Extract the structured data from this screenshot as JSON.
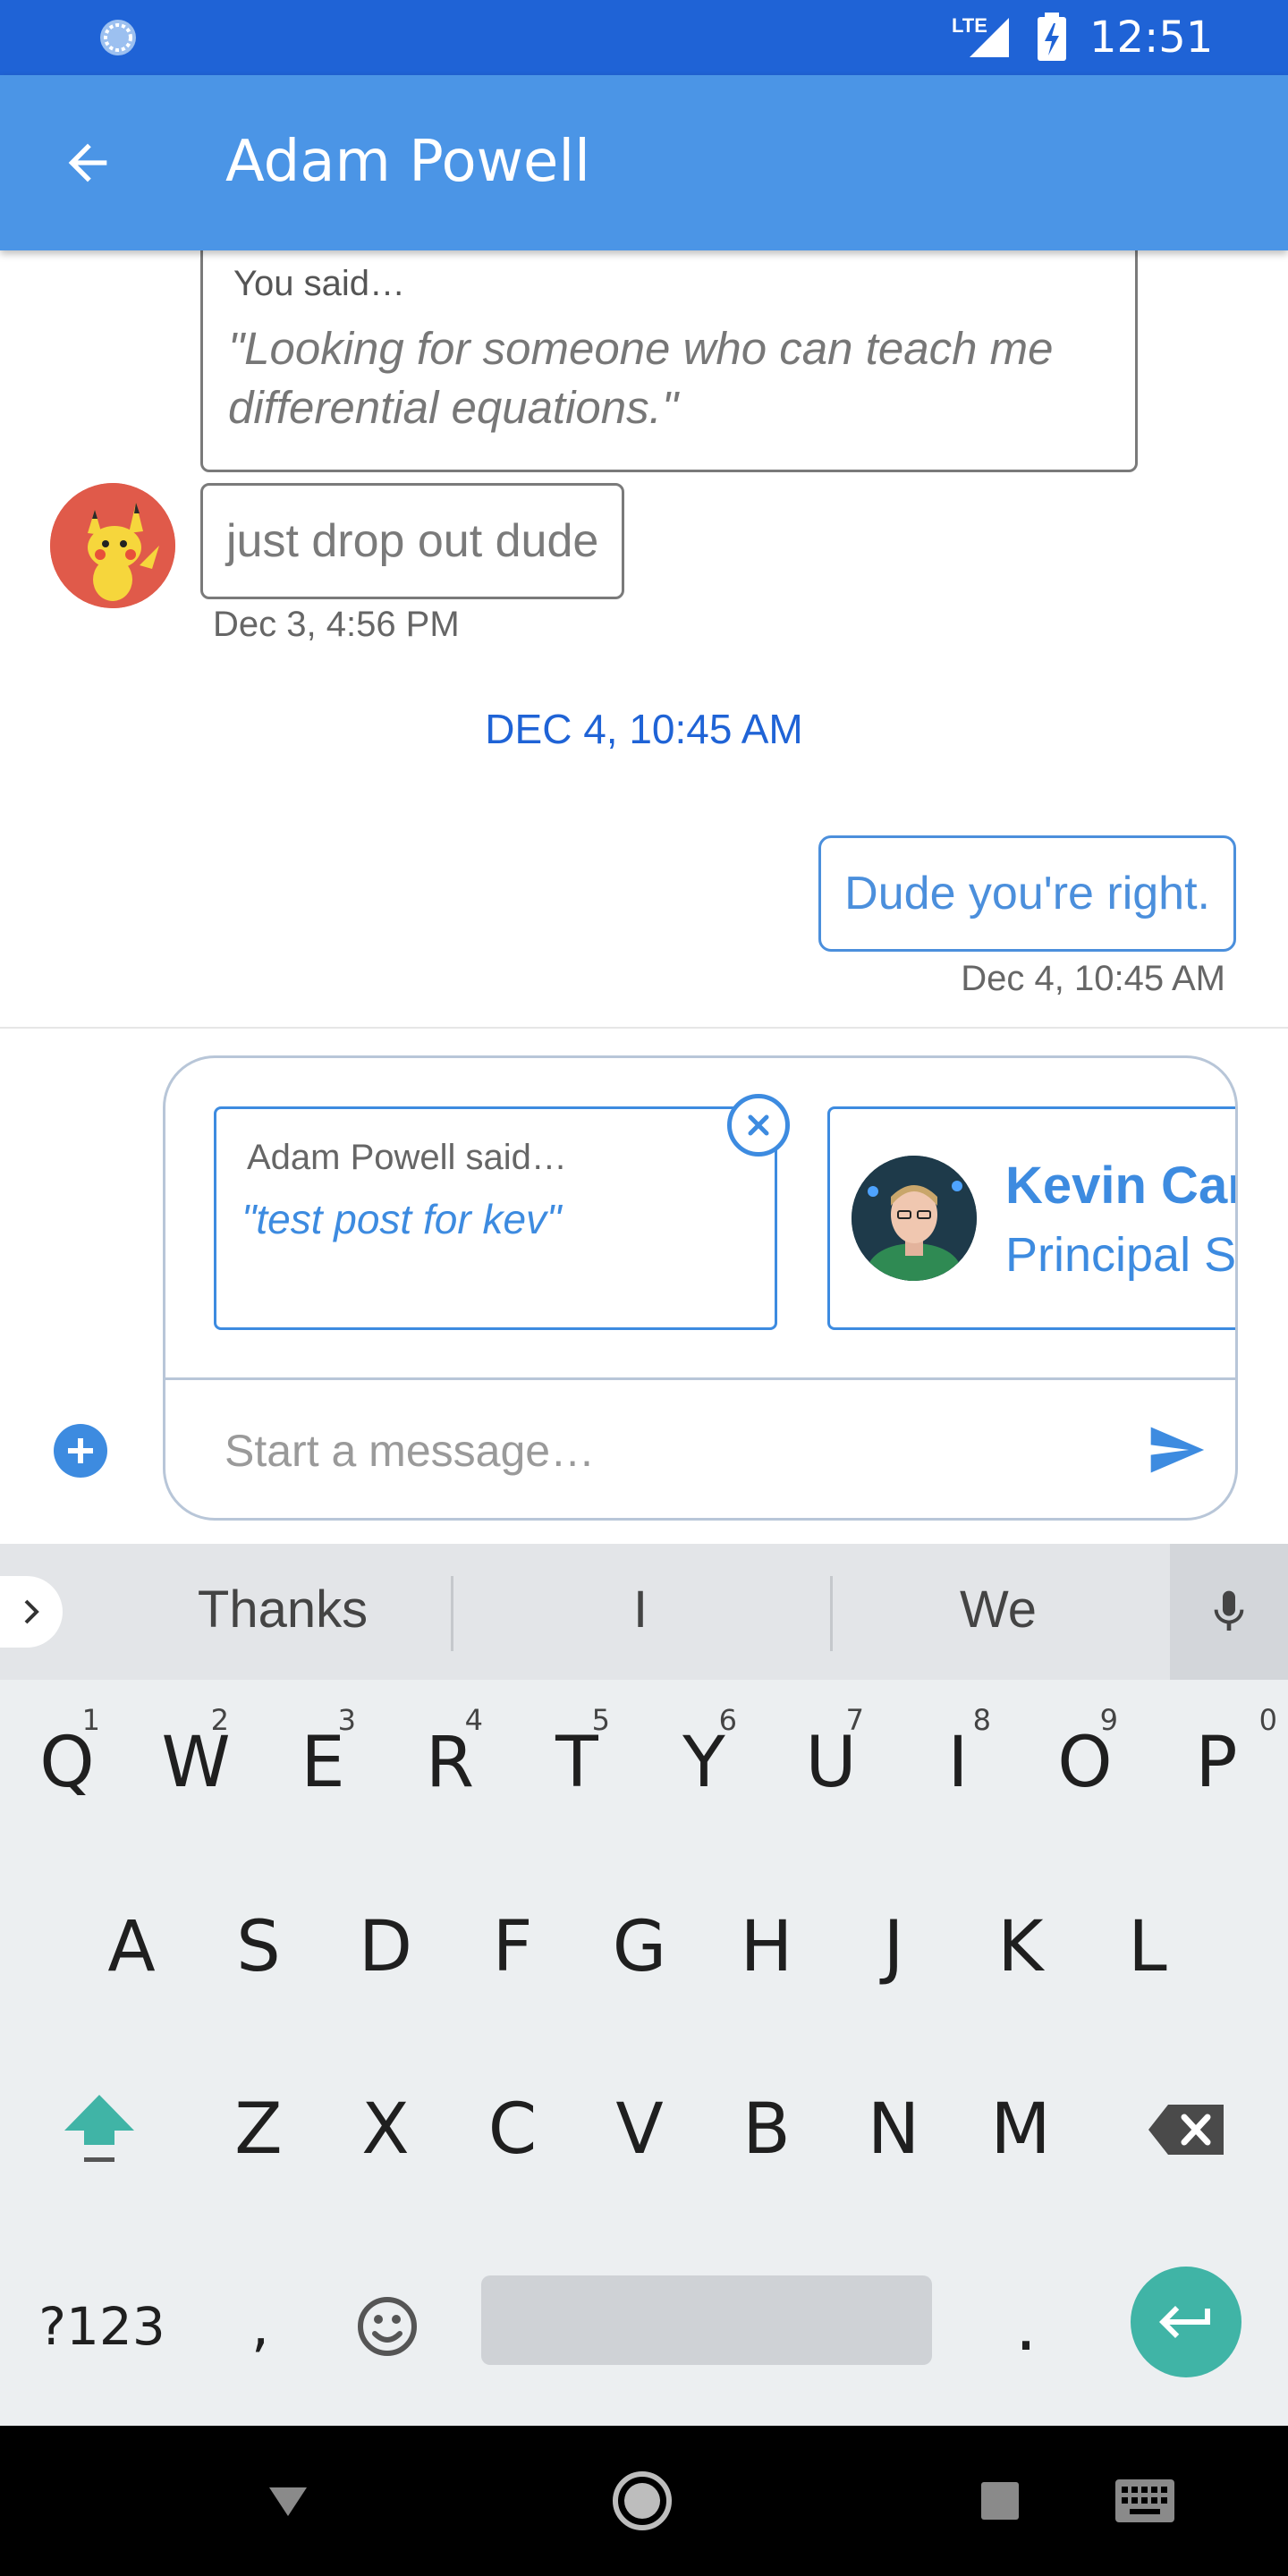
{
  "status_bar": {
    "network": "LTE",
    "time": "12:51"
  },
  "header": {
    "title": "Adam Powell"
  },
  "messages": {
    "quoted": {
      "label": "You said…",
      "text": "\"Looking for someone who can teach me differential equations.\""
    },
    "incoming": {
      "text": "just drop out dude",
      "timestamp": "Dec 3, 4:56 PM"
    },
    "date_separator": "DEC 4, 10:45 AM",
    "outgoing": {
      "text": "Dude you're right.",
      "timestamp": "Dec 4, 10:45 AM"
    }
  },
  "composer": {
    "attached_quote": {
      "label": "Adam Powell said…",
      "text": "\"test post for kev\""
    },
    "attached_contact": {
      "name": "Kevin Car",
      "title": "Principal S"
    },
    "placeholder": "Start a message…",
    "value": ""
  },
  "keyboard": {
    "suggestions": [
      "Thanks",
      "I",
      "We"
    ],
    "row1": [
      {
        "key": "Q",
        "hint": "1"
      },
      {
        "key": "W",
        "hint": "2"
      },
      {
        "key": "E",
        "hint": "3"
      },
      {
        "key": "R",
        "hint": "4"
      },
      {
        "key": "T",
        "hint": "5"
      },
      {
        "key": "Y",
        "hint": "6"
      },
      {
        "key": "U",
        "hint": "7"
      },
      {
        "key": "I",
        "hint": "8"
      },
      {
        "key": "O",
        "hint": "9"
      },
      {
        "key": "P",
        "hint": "0"
      }
    ],
    "row2": [
      "A",
      "S",
      "D",
      "F",
      "G",
      "H",
      "J",
      "K",
      "L"
    ],
    "row3": [
      "Z",
      "X",
      "C",
      "V",
      "B",
      "N",
      "M"
    ],
    "symbols_key": "?123",
    "comma_key": ",",
    "period_key": "."
  },
  "colors": {
    "status_bar": "#1f63d6",
    "app_bar": "#4b95e6",
    "accent": "#3d8be0",
    "enter_key": "#40b4a6"
  }
}
